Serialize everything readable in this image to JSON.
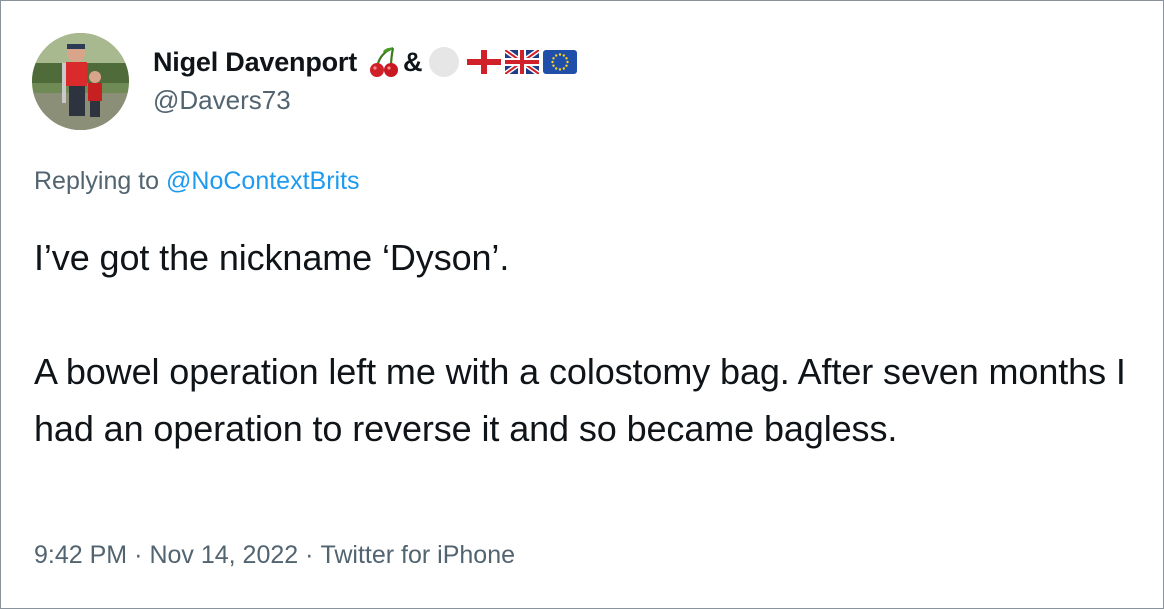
{
  "user": {
    "display_name": "Nigel Davenport",
    "ampersand": "&",
    "handle": "@Davers73",
    "name_emojis": [
      "cherries-icon",
      "white-circle-icon",
      "england-flag-icon",
      "uk-flag-icon",
      "eu-flag-icon"
    ]
  },
  "reply": {
    "prefix": "Replying to",
    "mention": "@NoContextBrits"
  },
  "tweet": {
    "paragraph_1": "I’ve got the nickname ‘Dyson’.",
    "paragraph_2": "A bowel operation left me with a colostomy bag. After seven months I had an operation to reverse it and so became bagless."
  },
  "meta": {
    "time": "9:42 PM",
    "separator": "·",
    "date": "Nov 14, 2022",
    "source": "Twitter for iPhone"
  },
  "colors": {
    "text_primary": "#0f1419",
    "text_secondary": "#536471",
    "link": "#1d9bf0",
    "border": "#8a939c"
  }
}
